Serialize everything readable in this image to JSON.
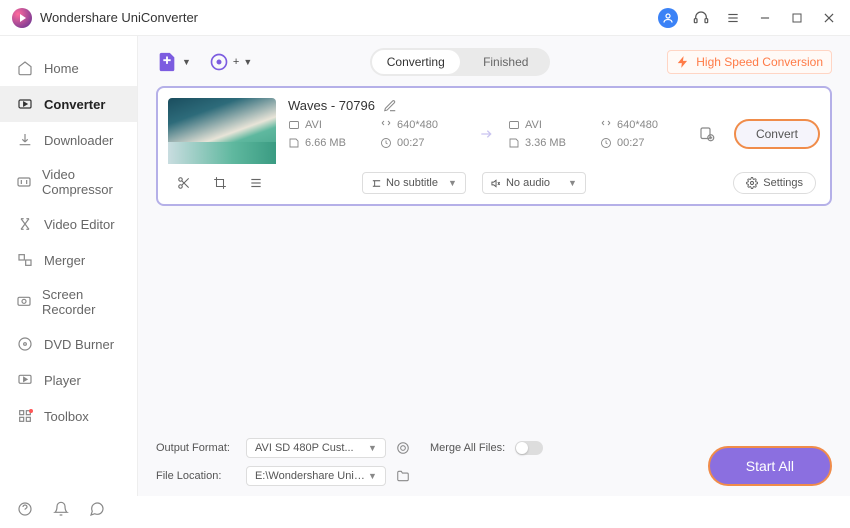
{
  "app": {
    "title": "Wondershare UniConverter"
  },
  "sidebar": {
    "items": [
      {
        "label": "Home"
      },
      {
        "label": "Converter"
      },
      {
        "label": "Downloader"
      },
      {
        "label": "Video Compressor"
      },
      {
        "label": "Video Editor"
      },
      {
        "label": "Merger"
      },
      {
        "label": "Screen Recorder"
      },
      {
        "label": "DVD Burner"
      },
      {
        "label": "Player"
      },
      {
        "label": "Toolbox"
      }
    ]
  },
  "tabs": {
    "converting": "Converting",
    "finished": "Finished"
  },
  "hsc": "High Speed Conversion",
  "file": {
    "title": "Waves - 70796",
    "src": {
      "format": "AVI",
      "res": "640*480",
      "size": "6.66 MB",
      "dur": "00:27"
    },
    "dst": {
      "format": "AVI",
      "res": "640*480",
      "size": "3.36 MB",
      "dur": "00:27"
    },
    "subtitle": "No subtitle",
    "audio": "No audio",
    "convert": "Convert",
    "settings": "Settings"
  },
  "footer": {
    "output_format_label": "Output Format:",
    "output_format_value": "AVI SD 480P Cust...",
    "file_location_label": "File Location:",
    "file_location_value": "E:\\Wondershare UniConverter",
    "merge_label": "Merge All Files:",
    "start_all": "Start All"
  }
}
